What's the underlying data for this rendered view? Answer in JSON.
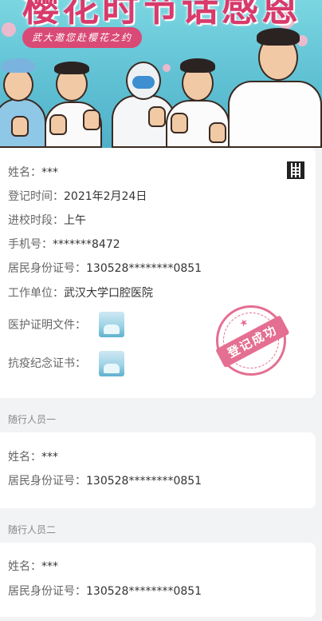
{
  "banner": {
    "title": "樱花时节话感恩",
    "slogan": "武大邀您赴樱花之约"
  },
  "main_card": {
    "name_label": "姓名：",
    "name_value": "***",
    "register_time_label": "登记时间：",
    "register_time_value": "2021年2月24日",
    "period_label": "进校时段：",
    "period_value": "上午",
    "phone_label": "手机号：",
    "phone_value": "*******8472",
    "id_label": "居民身份证号：",
    "id_value": "130528********0851",
    "workplace_label": "工作单位：",
    "workplace_value": "武汉大学口腔医院",
    "medical_doc_label": "医护证明文件：",
    "memorial_cert_label": "抗疫纪念证书：",
    "stamp_text": "登记成功"
  },
  "companion_1": {
    "section_label": "随行人员一",
    "name_label": "姓名：",
    "name_value": "***",
    "id_label": "居民身份证号：",
    "id_value": "130528********0851"
  },
  "companion_2": {
    "section_label": "随行人员二",
    "name_label": "姓名：",
    "name_value": "***",
    "id_label": "居民身份证号：",
    "id_value": "130528********0851"
  },
  "colors": {
    "accent_pink": "#e0567f",
    "banner_sky": "#64c4d6",
    "page_bg": "#f2f3f5"
  }
}
